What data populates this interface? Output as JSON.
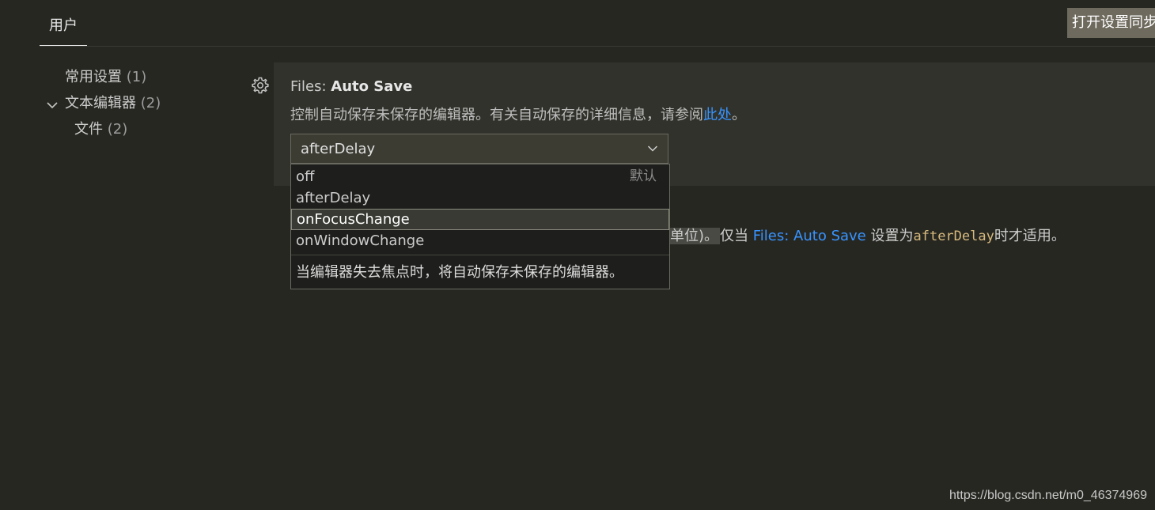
{
  "header": {
    "tab_user": "用户",
    "sync_button": "打开设置同步"
  },
  "tree": {
    "items": [
      {
        "label": "常用设置",
        "count": "(1)"
      },
      {
        "label": "文本编辑器",
        "count": "(2)"
      },
      {
        "label": "文件",
        "count": "(2)"
      }
    ]
  },
  "setting": {
    "title_category": "Files: ",
    "title_name": "Auto Save",
    "description": "控制自动保存未保存的编辑器。有关自动保存的详细信息，请参阅",
    "description_link": "此处",
    "description_end": "。",
    "selected_value": "afterDelay"
  },
  "dropdown": {
    "options": [
      {
        "label": "off",
        "tag": "默认"
      },
      {
        "label": "afterDelay"
      },
      {
        "label": "onFocusChange"
      },
      {
        "label": "onWindowChange"
      }
    ],
    "selected_index": 2,
    "description": "当编辑器失去焦点时，将自动保存未保存的编辑器。"
  },
  "delay_setting": {
    "partial_start": "单位)。",
    "text_a": "仅当 ",
    "link": "Files: Auto Save",
    "text_b": " 设置为",
    "code": "afterDelay",
    "text_c": "时才适用。"
  },
  "watermark": "https://blog.csdn.net/m0_46374969",
  "colors": {
    "background": "#272722",
    "panel": "#32322c",
    "link": "#3794ff",
    "code": "#d7ba7d"
  }
}
